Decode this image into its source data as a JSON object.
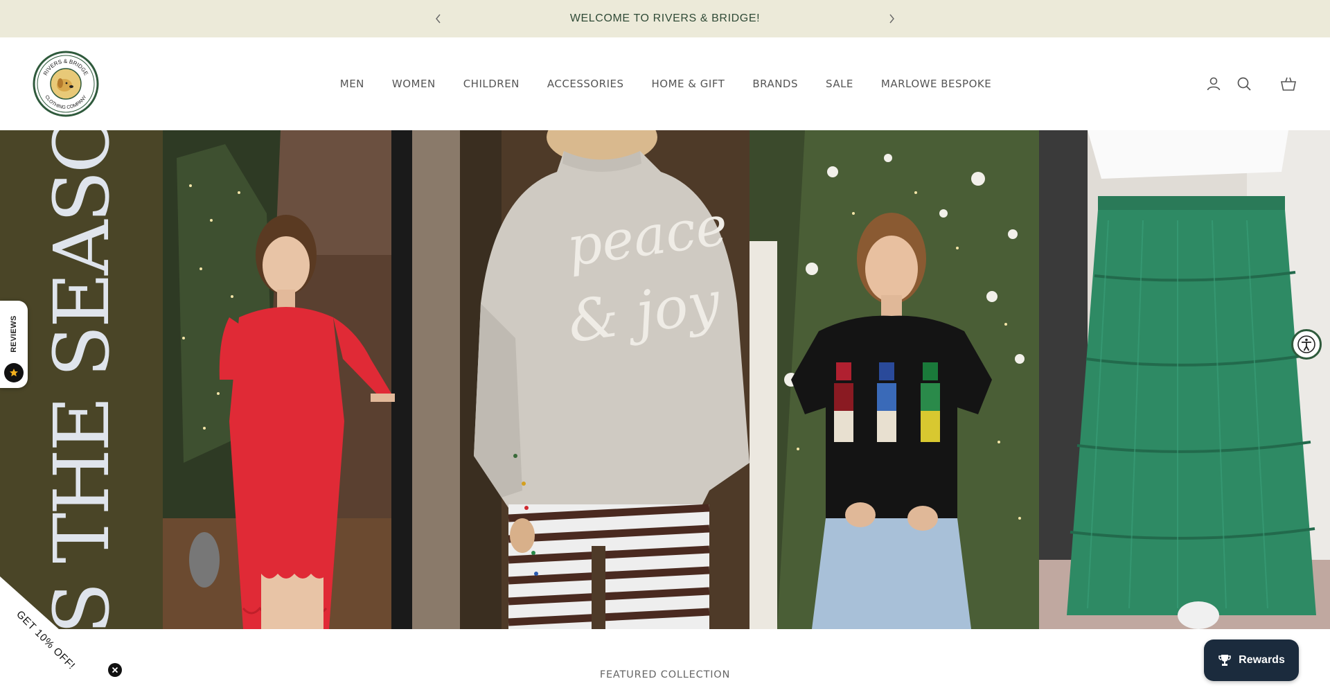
{
  "announcement": {
    "message": "WELCOME TO RIVERS & BRIDGE!",
    "prev_icon": "chevron-left-icon",
    "next_icon": "chevron-right-icon"
  },
  "logo": {
    "top_text": "RIVERS & BRIDGE",
    "bottom_text": "CLOTHING COMPANY"
  },
  "nav": {
    "items": [
      {
        "label": "MEN"
      },
      {
        "label": "WOMEN"
      },
      {
        "label": "CHILDREN"
      },
      {
        "label": "ACCESSORIES"
      },
      {
        "label": "HOME & GIFT"
      },
      {
        "label": "BRANDS"
      },
      {
        "label": "SALE"
      },
      {
        "label": "MARLOWE BESPOKE"
      }
    ]
  },
  "header_icons": [
    "account-icon",
    "search-icon",
    "cart-icon"
  ],
  "hero": {
    "title": "TIS THE SEASON",
    "panels": [
      "red-dress",
      "peace-joy-sweater",
      "nutcracker-sweater",
      "green-tulle-skirt"
    ],
    "sweater_text": "peace & joy"
  },
  "widgets": {
    "reviews_label": "REVIEWS",
    "promo_label": "GET 10% OFF!",
    "rewards_label": "Rewards"
  },
  "featured": {
    "label": "FEATURED COLLECTION"
  },
  "colors": {
    "announcement_bg": "#ecead9",
    "announcement_text": "#2f4a36",
    "banner_bg": "#4a4527",
    "banner_text": "#dfe4ec",
    "rewards_bg": "#1b2b3d",
    "accent_green": "#2f5a3c"
  }
}
